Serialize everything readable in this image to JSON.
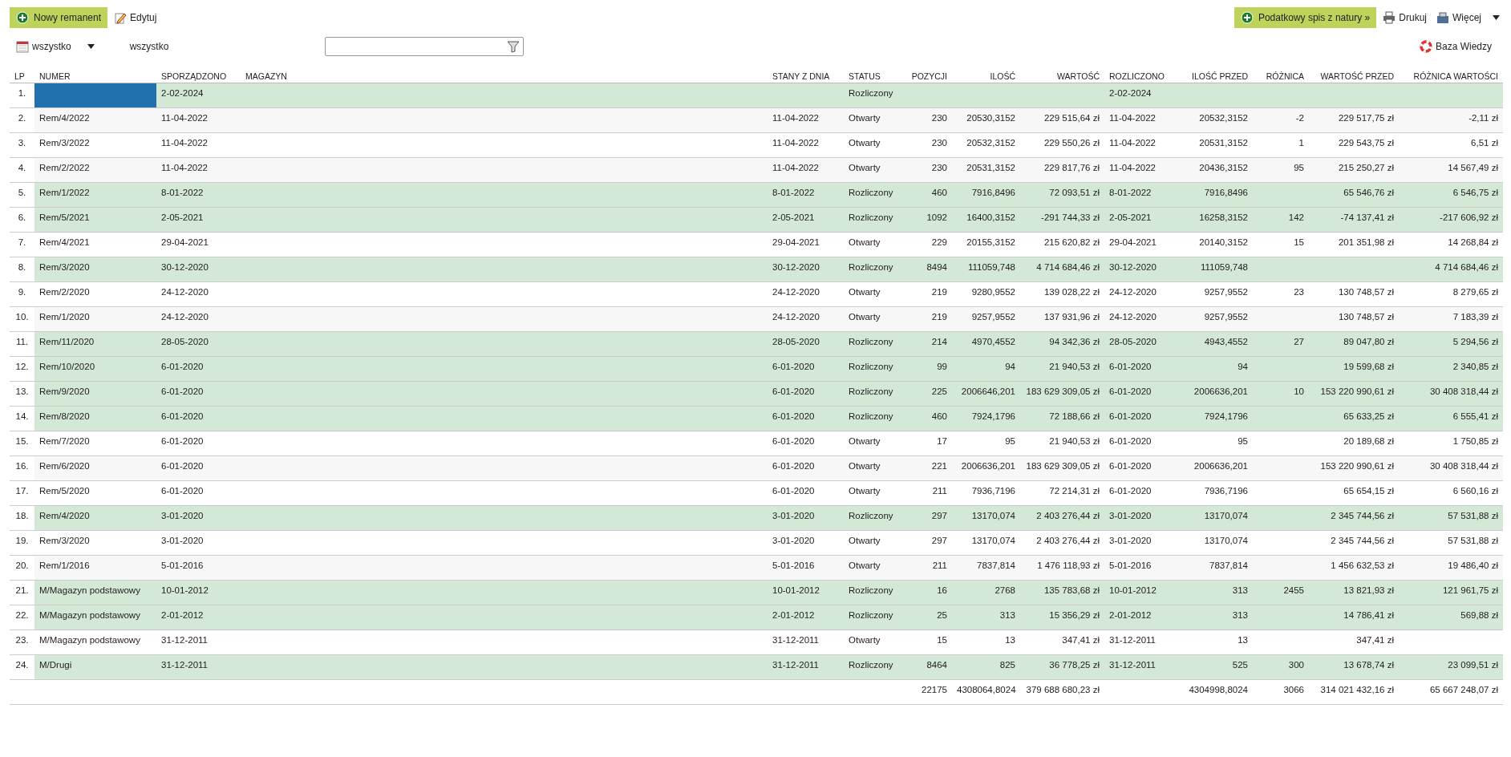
{
  "toolbar": {
    "new_button": "Nowy remanent",
    "edit_button": "Edytuj",
    "tax_button": "Podatkowy spis z natury »",
    "print_button": "Drukuj",
    "more_button": "Więcej"
  },
  "filters": {
    "period": "wszystko",
    "period_label": "wszystko",
    "help_link": "Baza Wiedzy"
  },
  "table": {
    "columns": [
      {
        "label": "LP"
      },
      {
        "label": "NUMER"
      },
      {
        "label": "SPORZĄDZONO"
      },
      {
        "label": "MAGAZYN"
      },
      {
        "label": "STANY Z DNIA"
      },
      {
        "label": "STATUS"
      },
      {
        "label": "POZYCJI"
      },
      {
        "label": "ILOŚĆ"
      },
      {
        "label": "WARTOŚĆ"
      },
      {
        "label": "ROZLICZONO"
      },
      {
        "label": "ILOŚĆ PRZED"
      },
      {
        "label": "RÓŻNICA"
      },
      {
        "label": "WARTOŚĆ PRZED"
      },
      {
        "label": "RÓŻNICA WARTOŚCI"
      }
    ],
    "rows": [
      {
        "lp": "1.",
        "sporzadzono": "2-02-2024",
        "status": "Rozliczony",
        "rozliczono": "2-02-2024",
        "settled": true,
        "selected": true
      },
      {
        "lp": "2.",
        "numer": "Rem/4/2022",
        "sporzadzono": "11-04-2022",
        "stany_z_dnia": "11-04-2022",
        "status": "Otwarty",
        "pozycji": "230",
        "ilosc": "20530,3152",
        "wartosc": "229 515,64 zł",
        "rozliczono": "11-04-2022",
        "ilosc_przed": "20532,3152",
        "roznica": "-2",
        "wartosc_przed": "229 517,75 zł",
        "roznica_wartosci": "-2,11 zł",
        "settled": false,
        "selected": false
      },
      {
        "lp": "3.",
        "numer": "Rem/3/2022",
        "sporzadzono": "11-04-2022",
        "stany_z_dnia": "11-04-2022",
        "status": "Otwarty",
        "pozycji": "230",
        "ilosc": "20532,3152",
        "wartosc": "229 550,26 zł",
        "rozliczono": "11-04-2022",
        "ilosc_przed": "20531,3152",
        "roznica": "1",
        "wartosc_przed": "229 543,75 zł",
        "roznica_wartosci": "6,51 zł",
        "settled": false,
        "selected": false
      },
      {
        "lp": "4.",
        "numer": "Rem/2/2022",
        "sporzadzono": "11-04-2022",
        "stany_z_dnia": "11-04-2022",
        "status": "Otwarty",
        "pozycji": "230",
        "ilosc": "20531,3152",
        "wartosc": "229 817,76 zł",
        "rozliczono": "11-04-2022",
        "ilosc_przed": "20436,3152",
        "roznica": "95",
        "wartosc_przed": "215 250,27 zł",
        "roznica_wartosci": "14 567,49 zł",
        "settled": false,
        "selected": false
      },
      {
        "lp": "5.",
        "numer": "Rem/1/2022",
        "sporzadzono": "8-01-2022",
        "stany_z_dnia": "8-01-2022",
        "status": "Rozliczony",
        "pozycji": "460",
        "ilosc": "7916,8496",
        "wartosc": "72 093,51 zł",
        "rozliczono": "8-01-2022",
        "ilosc_przed": "7916,8496",
        "wartosc_przed": "65 546,76 zł",
        "roznica_wartosci": "6 546,75 zł",
        "settled": true,
        "selected": false
      },
      {
        "lp": "6.",
        "numer": "Rem/5/2021",
        "sporzadzono": "2-05-2021",
        "stany_z_dnia": "2-05-2021",
        "status": "Rozliczony",
        "pozycji": "1092",
        "ilosc": "16400,3152",
        "wartosc": "-291 744,33 zł",
        "rozliczono": "2-05-2021",
        "ilosc_przed": "16258,3152",
        "roznica": "142",
        "wartosc_przed": "-74 137,41 zł",
        "roznica_wartosci": "-217 606,92 zł",
        "settled": true,
        "selected": false
      },
      {
        "lp": "7.",
        "numer": "Rem/4/2021",
        "sporzadzono": "29-04-2021",
        "stany_z_dnia": "29-04-2021",
        "status": "Otwarty",
        "pozycji": "229",
        "ilosc": "20155,3152",
        "wartosc": "215 620,82 zł",
        "rozliczono": "29-04-2021",
        "ilosc_przed": "20140,3152",
        "roznica": "15",
        "wartosc_przed": "201 351,98 zł",
        "roznica_wartosci": "14 268,84 zł",
        "settled": false,
        "selected": false
      },
      {
        "lp": "8.",
        "numer": "Rem/3/2020",
        "sporzadzono": "30-12-2020",
        "stany_z_dnia": "30-12-2020",
        "status": "Rozliczony",
        "pozycji": "8494",
        "ilosc": "111059,748",
        "wartosc": "4 714 684,46 zł",
        "rozliczono": "30-12-2020",
        "ilosc_przed": "111059,748",
        "roznica_wartosci": "4 714 684,46 zł",
        "settled": true,
        "selected": false
      },
      {
        "lp": "9.",
        "numer": "Rem/2/2020",
        "sporzadzono": "24-12-2020",
        "stany_z_dnia": "24-12-2020",
        "status": "Otwarty",
        "pozycji": "219",
        "ilosc": "9280,9552",
        "wartosc": "139 028,22 zł",
        "rozliczono": "24-12-2020",
        "ilosc_przed": "9257,9552",
        "roznica": "23",
        "wartosc_przed": "130 748,57 zł",
        "roznica_wartosci": "8 279,65 zł",
        "settled": false,
        "selected": false
      },
      {
        "lp": "10.",
        "numer": "Rem/1/2020",
        "sporzadzono": "24-12-2020",
        "stany_z_dnia": "24-12-2020",
        "status": "Otwarty",
        "pozycji": "219",
        "ilosc": "9257,9552",
        "wartosc": "137 931,96 zł",
        "rozliczono": "24-12-2020",
        "ilosc_przed": "9257,9552",
        "wartosc_przed": "130 748,57 zł",
        "roznica_wartosci": "7 183,39 zł",
        "settled": false,
        "selected": false
      },
      {
        "lp": "11.",
        "numer": "Rem/11/2020",
        "sporzadzono": "28-05-2020",
        "stany_z_dnia": "28-05-2020",
        "status": "Rozliczony",
        "pozycji": "214",
        "ilosc": "4970,4552",
        "wartosc": "94 342,36 zł",
        "rozliczono": "28-05-2020",
        "ilosc_przed": "4943,4552",
        "roznica": "27",
        "wartosc_przed": "89 047,80 zł",
        "roznica_wartosci": "5 294,56 zł",
        "settled": true,
        "selected": false
      },
      {
        "lp": "12.",
        "numer": "Rem/10/2020",
        "sporzadzono": "6-01-2020",
        "stany_z_dnia": "6-01-2020",
        "status": "Rozliczony",
        "pozycji": "99",
        "ilosc": "94",
        "wartosc": "21 940,53 zł",
        "rozliczono": "6-01-2020",
        "ilosc_przed": "94",
        "wartosc_przed": "19 599,68 zł",
        "roznica_wartosci": "2 340,85 zł",
        "settled": true,
        "selected": false
      },
      {
        "lp": "13.",
        "numer": "Rem/9/2020",
        "sporzadzono": "6-01-2020",
        "stany_z_dnia": "6-01-2020",
        "status": "Rozliczony",
        "pozycji": "225",
        "ilosc": "2006646,201",
        "wartosc": "183 629 309,05 zł",
        "rozliczono": "6-01-2020",
        "ilosc_przed": "2006636,201",
        "roznica": "10",
        "wartosc_przed": "153 220 990,61 zł",
        "roznica_wartosci": "30 408 318,44 zł",
        "settled": true,
        "selected": false
      },
      {
        "lp": "14.",
        "numer": "Rem/8/2020",
        "sporzadzono": "6-01-2020",
        "stany_z_dnia": "6-01-2020",
        "status": "Rozliczony",
        "pozycji": "460",
        "ilosc": "7924,1796",
        "wartosc": "72 188,66 zł",
        "rozliczono": "6-01-2020",
        "ilosc_przed": "7924,1796",
        "wartosc_przed": "65 633,25 zł",
        "roznica_wartosci": "6 555,41 zł",
        "settled": true,
        "selected": false
      },
      {
        "lp": "15.",
        "numer": "Rem/7/2020",
        "sporzadzono": "6-01-2020",
        "stany_z_dnia": "6-01-2020",
        "status": "Otwarty",
        "pozycji": "17",
        "ilosc": "95",
        "wartosc": "21 940,53 zł",
        "rozliczono": "6-01-2020",
        "ilosc_przed": "95",
        "wartosc_przed": "20 189,68 zł",
        "roznica_wartosci": "1 750,85 zł",
        "settled": false,
        "selected": false
      },
      {
        "lp": "16.",
        "numer": "Rem/6/2020",
        "sporzadzono": "6-01-2020",
        "stany_z_dnia": "6-01-2020",
        "status": "Otwarty",
        "pozycji": "221",
        "ilosc": "2006636,201",
        "wartosc": "183 629 309,05 zł",
        "rozliczono": "6-01-2020",
        "ilosc_przed": "2006636,201",
        "wartosc_przed": "153 220 990,61 zł",
        "roznica_wartosci": "30 408 318,44 zł",
        "settled": false,
        "selected": false
      },
      {
        "lp": "17.",
        "numer": "Rem/5/2020",
        "sporzadzono": "6-01-2020",
        "stany_z_dnia": "6-01-2020",
        "status": "Otwarty",
        "pozycji": "211",
        "ilosc": "7936,7196",
        "wartosc": "72 214,31 zł",
        "rozliczono": "6-01-2020",
        "ilosc_przed": "7936,7196",
        "wartosc_przed": "65 654,15 zł",
        "roznica_wartosci": "6 560,16 zł",
        "settled": false,
        "selected": false
      },
      {
        "lp": "18.",
        "numer": "Rem/4/2020",
        "sporzadzono": "3-01-2020",
        "stany_z_dnia": "3-01-2020",
        "status": "Rozliczony",
        "pozycji": "297",
        "ilosc": "13170,074",
        "wartosc": "2 403 276,44 zł",
        "rozliczono": "3-01-2020",
        "ilosc_przed": "13170,074",
        "wartosc_przed": "2 345 744,56 zł",
        "roznica_wartosci": "57 531,88 zł",
        "settled": true,
        "selected": false
      },
      {
        "lp": "19.",
        "numer": "Rem/3/2020",
        "sporzadzono": "3-01-2020",
        "stany_z_dnia": "3-01-2020",
        "status": "Otwarty",
        "pozycji": "297",
        "ilosc": "13170,074",
        "wartosc": "2 403 276,44 zł",
        "rozliczono": "3-01-2020",
        "ilosc_przed": "13170,074",
        "wartosc_przed": "2 345 744,56 zł",
        "roznica_wartosci": "57 531,88 zł",
        "settled": false,
        "selected": false
      },
      {
        "lp": "20.",
        "numer": "Rem/1/2016",
        "sporzadzono": "5-01-2016",
        "stany_z_dnia": "5-01-2016",
        "status": "Otwarty",
        "pozycji": "211",
        "ilosc": "7837,814",
        "wartosc": "1 476 118,93 zł",
        "rozliczono": "5-01-2016",
        "ilosc_przed": "7837,814",
        "wartosc_przed": "1 456 632,53 zł",
        "roznica_wartosci": "19 486,40 zł",
        "settled": false,
        "selected": false
      },
      {
        "lp": "21.",
        "numer": "M/Magazyn podstawowy",
        "sporzadzono": "10-01-2012",
        "stany_z_dnia": "10-01-2012",
        "status": "Rozliczony",
        "pozycji": "16",
        "ilosc": "2768",
        "wartosc": "135 783,68 zł",
        "rozliczono": "10-01-2012",
        "ilosc_przed": "313",
        "roznica": "2455",
        "wartosc_przed": "13 821,93 zł",
        "roznica_wartosci": "121 961,75 zł",
        "settled": true,
        "selected": false
      },
      {
        "lp": "22.",
        "numer": "M/Magazyn podstawowy",
        "sporzadzono": "2-01-2012",
        "stany_z_dnia": "2-01-2012",
        "status": "Rozliczony",
        "pozycji": "25",
        "ilosc": "313",
        "wartosc": "15 356,29 zł",
        "rozliczono": "2-01-2012",
        "ilosc_przed": "313",
        "wartosc_przed": "14 786,41 zł",
        "roznica_wartosci": "569,88 zł",
        "settled": true,
        "selected": false
      },
      {
        "lp": "23.",
        "numer": "M/Magazyn podstawowy",
        "sporzadzono": "31-12-2011",
        "stany_z_dnia": "31-12-2011",
        "status": "Otwarty",
        "pozycji": "15",
        "ilosc": "13",
        "wartosc": "347,41 zł",
        "rozliczono": "31-12-2011",
        "ilosc_przed": "13",
        "wartosc_przed": "347,41 zł",
        "settled": false,
        "selected": false
      },
      {
        "lp": "24.",
        "numer": "M/Drugi",
        "sporzadzono": "31-12-2011",
        "stany_z_dnia": "31-12-2011",
        "status": "Rozliczony",
        "pozycji": "8464",
        "ilosc": "825",
        "wartosc": "36 778,25 zł",
        "rozliczono": "31-12-2011",
        "ilosc_przed": "525",
        "roznica": "300",
        "wartosc_przed": "13 678,74 zł",
        "roznica_wartosci": "23 099,51 zł",
        "settled": true,
        "selected": false
      }
    ],
    "totals": {
      "pozycji": "22175",
      "ilosc": "4308064,8024",
      "wartosc": "379 688 680,23 zł",
      "ilosc_przed": "4304998,8024",
      "roznica": "3066",
      "wartosc_przed": "314 021 432,16 zł",
      "roznica_wartosci": "65 667 248,07 zł"
    }
  }
}
